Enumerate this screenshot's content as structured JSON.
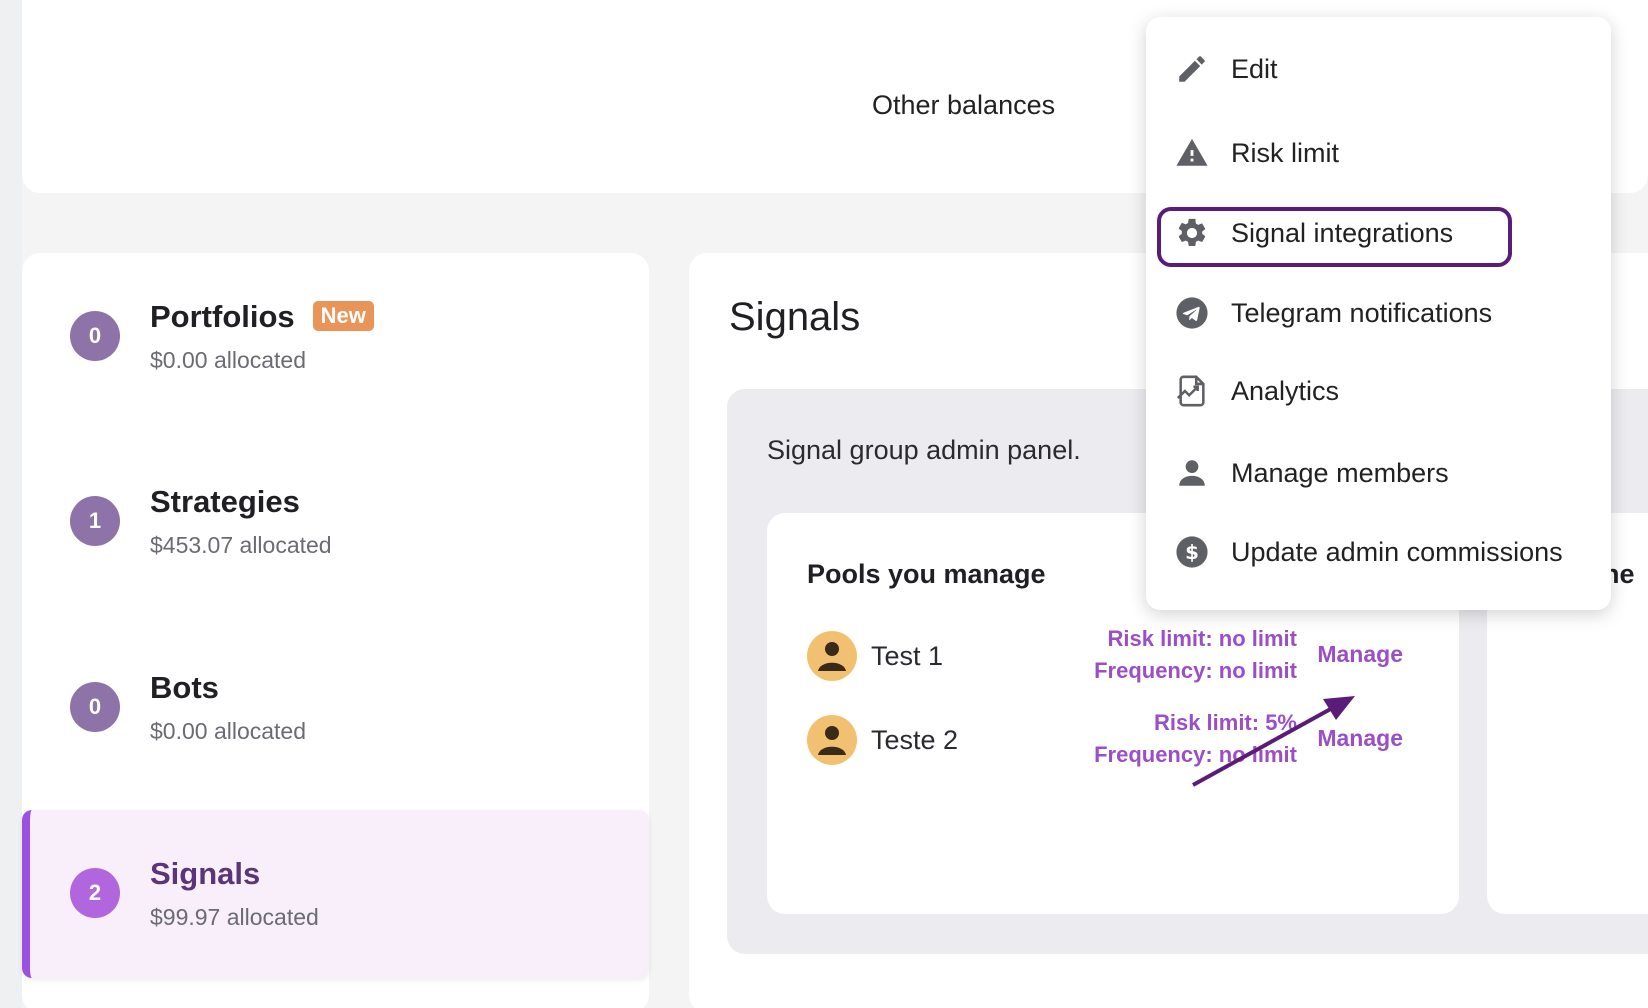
{
  "balances": {
    "other_label": "Other balances"
  },
  "nav": {
    "items": [
      {
        "count": "0",
        "title": "Portfolios",
        "badge": "New",
        "allocated": "$0.00 allocated"
      },
      {
        "count": "1",
        "title": "Strategies",
        "allocated": "$453.07 allocated"
      },
      {
        "count": "0",
        "title": "Bots",
        "allocated": "$0.00 allocated"
      },
      {
        "count": "2",
        "title": "Signals",
        "allocated": "$99.97 allocated",
        "active": true
      }
    ]
  },
  "main": {
    "heading": "Signals",
    "admin_panel_text": "Signal group admin panel.",
    "pools": {
      "title": "Pools you manage",
      "rows": [
        {
          "name": "Test 1",
          "risk": "Risk limit: no limit",
          "frequency": "Frequency: no limit",
          "action": "Manage"
        },
        {
          "name": "Teste 2",
          "risk": "Risk limit: 5%",
          "frequency": "Frequency: no limit",
          "action": "Manage"
        }
      ]
    },
    "second_card_title_fragment": "ne"
  },
  "menu": {
    "items": [
      {
        "icon": "pencil-icon",
        "label": "Edit"
      },
      {
        "icon": "warning-icon",
        "label": "Risk limit"
      },
      {
        "icon": "gear-icon",
        "label": "Signal integrations",
        "highlighted": true
      },
      {
        "icon": "telegram-icon",
        "label": "Telegram notifications"
      },
      {
        "icon": "analytics-icon",
        "label": "Analytics"
      },
      {
        "icon": "person-icon",
        "label": "Manage members"
      },
      {
        "icon": "dollar-icon",
        "label": "Update admin commissions"
      }
    ]
  },
  "colors": {
    "accent": "#9b51e0",
    "link": "#9b4fc7",
    "highlight_border": "#5a1c78",
    "new_badge": "#e9955a",
    "avatar": "#f2c071"
  }
}
